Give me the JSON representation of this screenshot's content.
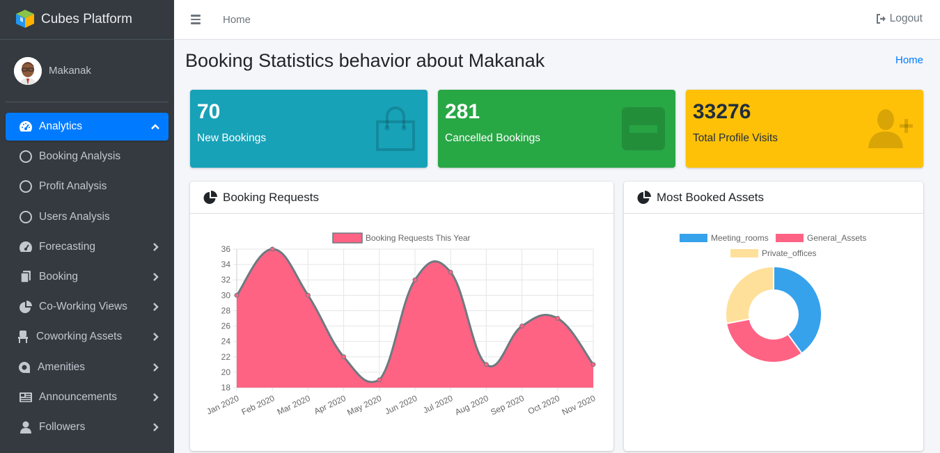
{
  "brand": {
    "name": "Cubes Platform"
  },
  "user": {
    "name": "Makanak"
  },
  "sidebar": {
    "items": [
      {
        "label": "Analytics",
        "icon": "tachometer-icon",
        "active": true,
        "arrow": "up"
      },
      {
        "label": "Booking Analysis",
        "icon": "circle-icon",
        "sub": true
      },
      {
        "label": "Profit Analysis",
        "icon": "circle-icon",
        "sub": true
      },
      {
        "label": "Users Analysis",
        "icon": "circle-icon",
        "sub": true
      },
      {
        "label": "Forecasting",
        "icon": "tachometer-icon",
        "arrow": "right"
      },
      {
        "label": "Booking",
        "icon": "copy-icon",
        "arrow": "right"
      },
      {
        "label": "Co-Working Views",
        "icon": "pie-chart-icon",
        "arrow": "right"
      },
      {
        "label": "Coworking Assets",
        "icon": "chair-icon",
        "arrow": "right"
      },
      {
        "label": "Amenities",
        "icon": "amenities-icon",
        "arrow": "right"
      },
      {
        "label": "Announcements",
        "icon": "newspaper-icon",
        "arrow": "right"
      },
      {
        "label": "Followers",
        "icon": "user-icon",
        "arrow": "right"
      }
    ]
  },
  "topbar": {
    "home": "Home",
    "logout": "Logout"
  },
  "page": {
    "title": "Booking Statistics behavior about Makanak",
    "breadcrumb": "Home"
  },
  "stats": [
    {
      "value": "70",
      "label": "New Bookings",
      "icon": "shopping-bag-icon",
      "color": "#17a2b8"
    },
    {
      "value": "281",
      "label": "Cancelled Bookings",
      "icon": "minus-square-icon",
      "color": "#28a745"
    },
    {
      "value": "33276",
      "label": "Total Profile Visits",
      "icon": "user-plus-icon",
      "color": "#ffc107"
    }
  ],
  "cards": {
    "booking_requests": {
      "title": "Booking Requests"
    },
    "most_booked": {
      "title": "Most Booked Assets"
    }
  },
  "chart_data": [
    {
      "type": "area",
      "categories": [
        "Jan 2020",
        "Feb 2020",
        "Mar 2020",
        "Apr 2020",
        "May 2020",
        "Jun 2020",
        "Jul 2020",
        "Aug 2020",
        "Sep 2020",
        "Oct 2020",
        "Nov 2020"
      ],
      "series": [
        {
          "name": "Booking Requests This Year",
          "values": [
            30,
            36,
            30,
            22,
            19,
            32,
            33,
            21,
            26,
            27,
            21
          ],
          "color": "#ff6384",
          "border": "#6c7a80"
        }
      ],
      "yticks": [
        18,
        20,
        22,
        24,
        26,
        28,
        30,
        32,
        34,
        36
      ],
      "ylim": [
        18,
        36
      ],
      "grid": true,
      "legend": "top"
    },
    {
      "type": "pie",
      "labels": [
        "Meeting_rooms",
        "General_Assets",
        "Private_offices"
      ],
      "values": [
        40,
        32,
        28
      ],
      "colors": [
        "#36a2eb",
        "#ff6384",
        "#ffe09a"
      ],
      "legend": "top"
    }
  ]
}
